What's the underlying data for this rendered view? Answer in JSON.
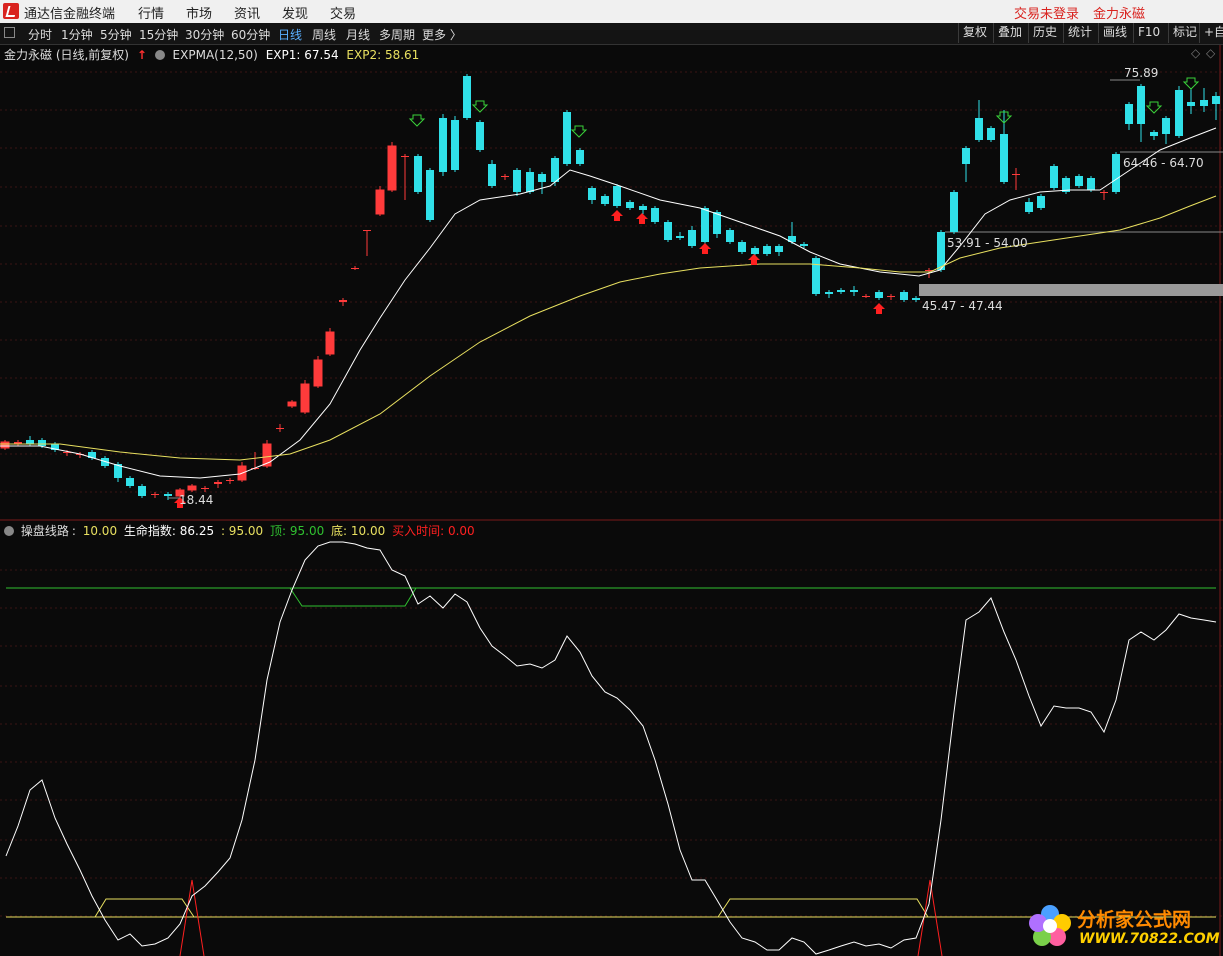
{
  "menubar": {
    "app_title": "通达信金融终端",
    "menus": [
      "行情",
      "市场",
      "资讯",
      "发现",
      "交易"
    ],
    "login_status": "交易未登录",
    "stock_name": "金力永磁"
  },
  "toolbar": {
    "periods": [
      "分时",
      "1分钟",
      "5分钟",
      "15分钟",
      "30分钟",
      "60分钟",
      "日线",
      "周线",
      "月线",
      "多周期",
      "更多 〉"
    ],
    "active_period": "日线",
    "buttons": [
      "复权",
      "叠加",
      "历史",
      "统计",
      "画线",
      "F10",
      "标记",
      "+自"
    ]
  },
  "main_chart": {
    "stock_label": "金力永磁 (日线,前复权)",
    "indicator": "EXPMA(12,50)",
    "exp1_label": "EXP1: 67.54",
    "exp2_label": "EXP2: 58.61",
    "annotations": {
      "high": "75.89",
      "low": "18.44",
      "zone_top": "64.46 - 64.70",
      "zone_mid": "53.91 - 54.00",
      "zone_low": "45.47 - 47.44"
    },
    "colors": {
      "up": "#ff3b3b",
      "down": "#30e0e8",
      "exp1": "#ffffff",
      "exp2": "#e8e060"
    }
  },
  "indicator_panel": {
    "name": "操盘线路",
    "line_value": "10.00",
    "life_label": "生命指数: 86.25",
    "life_ext": ": 95.00",
    "top_label": "顶: 95.00",
    "bottom_label": "底: 10.00",
    "buy_label": "买入时间: 0.00",
    "colors": {
      "top": "#30c030",
      "bottom": "#e8e060",
      "buy": "#ff2020"
    }
  },
  "watermark": {
    "line1": "分析家公式网",
    "line2": "WWW.70822.COM"
  }
}
